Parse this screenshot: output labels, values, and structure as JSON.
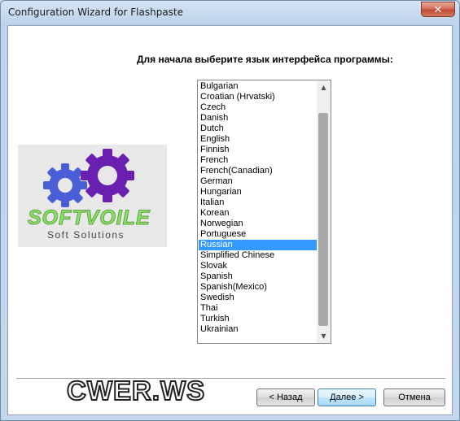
{
  "window": {
    "title": "Configuration Wizard for Flashpaste",
    "close_glyph": "✕"
  },
  "prompt": "Для начала выберите язык интерфейса программы:",
  "logo": {
    "text": "SOFTVOILE",
    "subtitle": "Soft Solutions"
  },
  "languages": {
    "selected": "Russian",
    "items": [
      "Bulgarian",
      "Croatian (Hrvatski)",
      "Czech",
      "Danish",
      "Dutch",
      "English",
      "Finnish",
      "French",
      "French(Canadian)",
      "German",
      "Hungarian",
      "Italian",
      "Korean",
      "Norwegian",
      "Portuguese",
      "Russian",
      "Simplified Chinese",
      "Slovak",
      "Spanish",
      "Spanish(Mexico)",
      "Swedish",
      "Thai",
      "Turkish",
      "Ukrainian"
    ]
  },
  "scrollbar": {
    "up_glyph": "▲",
    "down_glyph": "▼"
  },
  "watermark": {
    "text": "CWER.WS"
  },
  "buttons": {
    "back": "< Назад",
    "next": "Далее >",
    "cancel": "Отмена"
  }
}
